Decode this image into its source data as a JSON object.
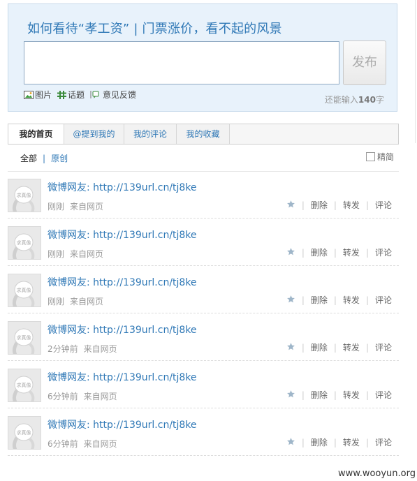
{
  "composer": {
    "topic": "如何看待“孝工资” | 门票涨价，看不起的风景",
    "send_label": "发布",
    "tools": [
      {
        "icon": "image-icon",
        "label": "图片"
      },
      {
        "icon": "topic-icon",
        "label": "话题"
      },
      {
        "icon": "feedback-icon",
        "label": "意见反馈"
      }
    ],
    "counter_prefix": "还能输入",
    "counter_value": "140",
    "counter_suffix": "字"
  },
  "tabs": [
    "我的首页",
    "@提到我的",
    "我的评论",
    "我的收藏"
  ],
  "filter": {
    "all": "全部",
    "separator": "|",
    "original": "原创",
    "simple": "精简"
  },
  "feed": [
    {
      "author": "微博网友:",
      "link": "http://139url.cn/tj8ke",
      "time": "刚刚",
      "source": "来自网页"
    },
    {
      "author": "微博网友:",
      "link": "http://139url.cn/tj8ke",
      "time": "刚刚",
      "source": "来自网页"
    },
    {
      "author": "微博网友:",
      "link": "http://139url.cn/tj8ke",
      "time": "刚刚",
      "source": "来自网页"
    },
    {
      "author": "微博网友:",
      "link": "http://139url.cn/tj8ke",
      "time": "2分钟前",
      "source": "来自网页"
    },
    {
      "author": "微博网友:",
      "link": "http://139url.cn/tj8ke",
      "time": "6分钟前",
      "source": "来自网页"
    },
    {
      "author": "微博网友:",
      "link": "http://139url.cn/tj8ke",
      "time": "6分钟前",
      "source": "来自网页"
    }
  ],
  "actions": {
    "delete": "删除",
    "forward": "转发",
    "comment": "评论"
  },
  "avatar_caption": "求真像",
  "watermark": "www.wooyun.org",
  "colors": {
    "link": "#2f78b6",
    "composer_bg": "#e8f2fb"
  }
}
